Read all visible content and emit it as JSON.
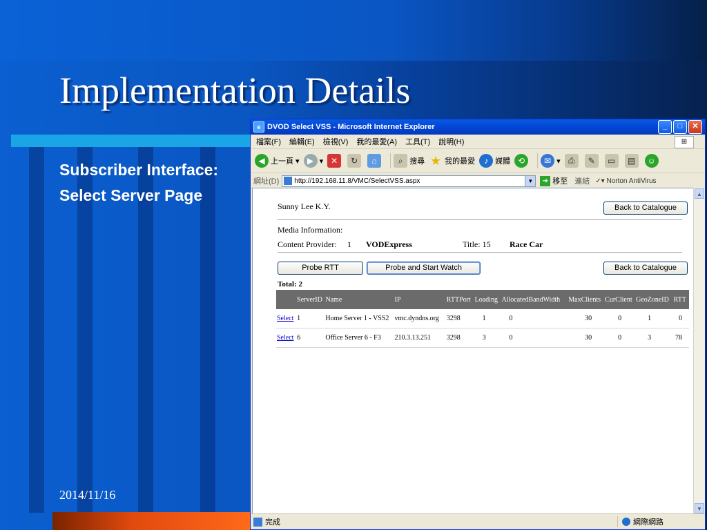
{
  "slide": {
    "title": "Implementation Details",
    "subtitle_lines": [
      "Subscriber Interface:",
      "Select Server Page"
    ],
    "date": "2014/11/16"
  },
  "browser": {
    "window_title": "DVOD Select VSS - Microsoft Internet Explorer",
    "menu": [
      "檔案(F)",
      "編輯(E)",
      "檢視(V)",
      "我的最愛(A)",
      "工具(T)",
      "說明(H)"
    ],
    "toolbar": {
      "back": "上一頁",
      "search": "搜尋",
      "favorites": "我的最愛",
      "media": "媒體"
    },
    "address": {
      "label": "網址(D)",
      "url": "http://192.168.11.8/VMC/SelectVSS.aspx",
      "go": "移至",
      "links": "連結",
      "norton": "Norton AntiVirus"
    },
    "status": {
      "text": "完成",
      "zone": "網際網路"
    }
  },
  "page": {
    "user": "Sunny Lee K.Y.",
    "back_to_catalogue": "Back to Catalogue",
    "media_info_label": "Media Information:",
    "content_provider_label": "Content Provider:",
    "content_provider_id": "1",
    "content_provider_name": "VODExpress",
    "title_label": "Title: 15",
    "title_name": "Race Car",
    "probe_rtt": "Probe RTT",
    "probe_and_start": "Probe and Start Watch",
    "total": "Total: 2",
    "columns": [
      "",
      "ServerID",
      "Name",
      "IP",
      "RTTPort",
      "Loading",
      "AllocatedBandWidth",
      "MaxClients",
      "CurClient",
      "GeoZoneID",
      "RTT"
    ],
    "rows": [
      {
        "select": "Select",
        "server_id": "1",
        "name": "Home Server 1 - VSS2",
        "ip": "vmc.dyndns.org",
        "rtt_port": "3298",
        "loading": "1",
        "allocated_bw": "0",
        "max_clients": "30",
        "cur_client": "0",
        "geo_zone": "1",
        "rtt": "0"
      },
      {
        "select": "Select",
        "server_id": "6",
        "name": "Office Server 6 - F3",
        "ip": "210.3.13.251",
        "rtt_port": "3298",
        "loading": "3",
        "allocated_bw": "0",
        "max_clients": "30",
        "cur_client": "0",
        "geo_zone": "3",
        "rtt": "78"
      }
    ]
  }
}
